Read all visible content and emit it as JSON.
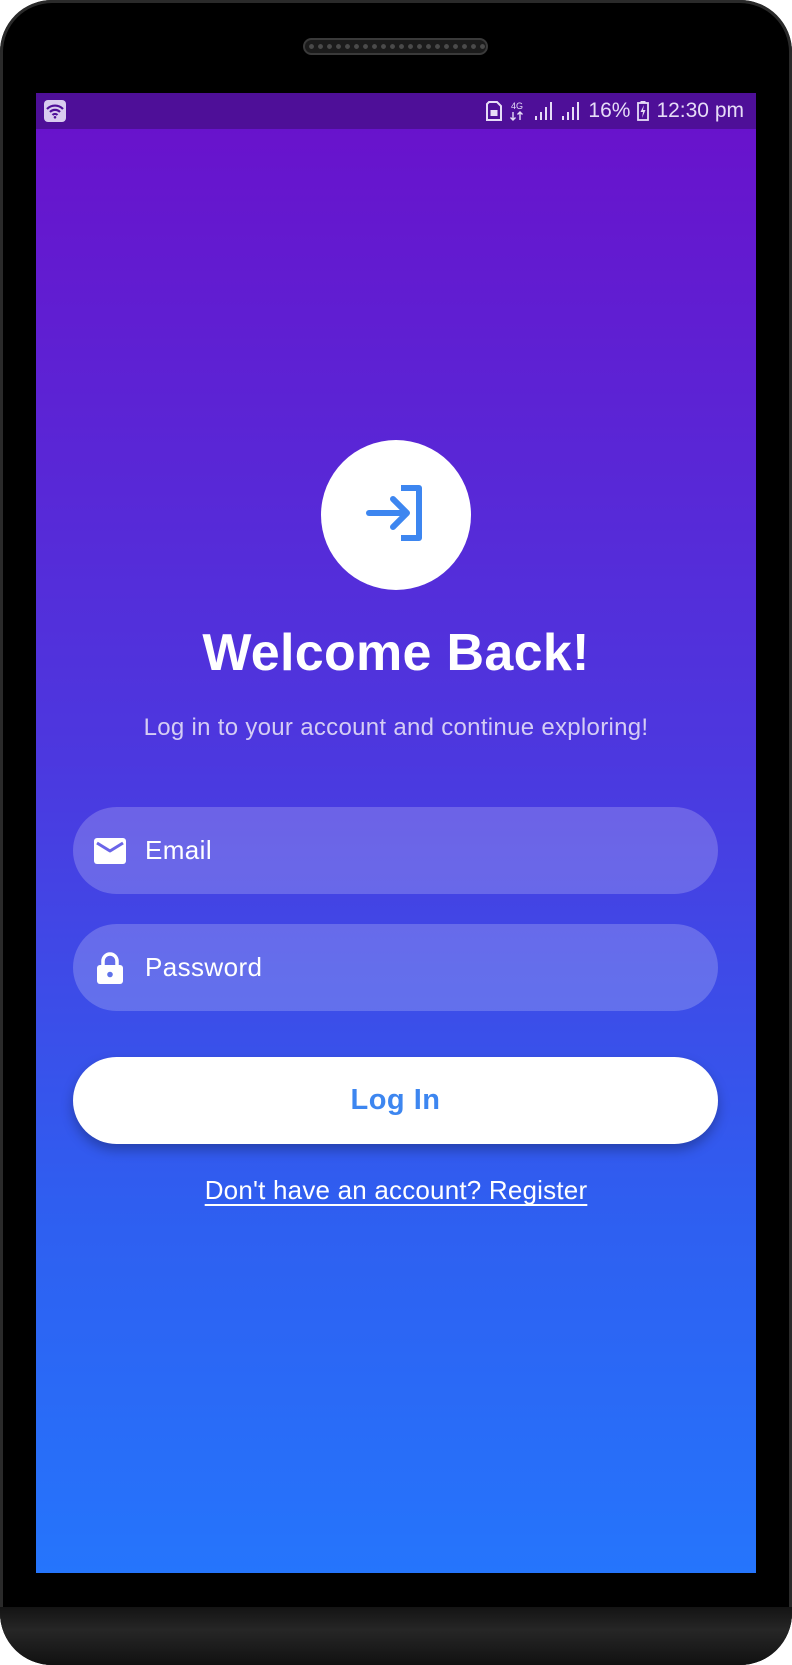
{
  "status_bar": {
    "battery_percent": "16%",
    "time": "12:30 pm",
    "network": "4G",
    "background_color": "#4e0f98"
  },
  "hero_icon": "login-arrow-icon",
  "title": "Welcome Back!",
  "subtitle": "Log in to your account and continue exploring!",
  "form": {
    "email": {
      "placeholder": "Email",
      "value": "",
      "icon": "mail-icon"
    },
    "password": {
      "placeholder": "Password",
      "value": "",
      "icon": "lock-icon"
    },
    "submit_label": "Log In"
  },
  "register_link": "Don't have an account? Register",
  "colors": {
    "gradient_top": "#6a11cb",
    "gradient_bottom": "#2575fc",
    "accent": "#3d86f0",
    "white": "#ffffff"
  }
}
